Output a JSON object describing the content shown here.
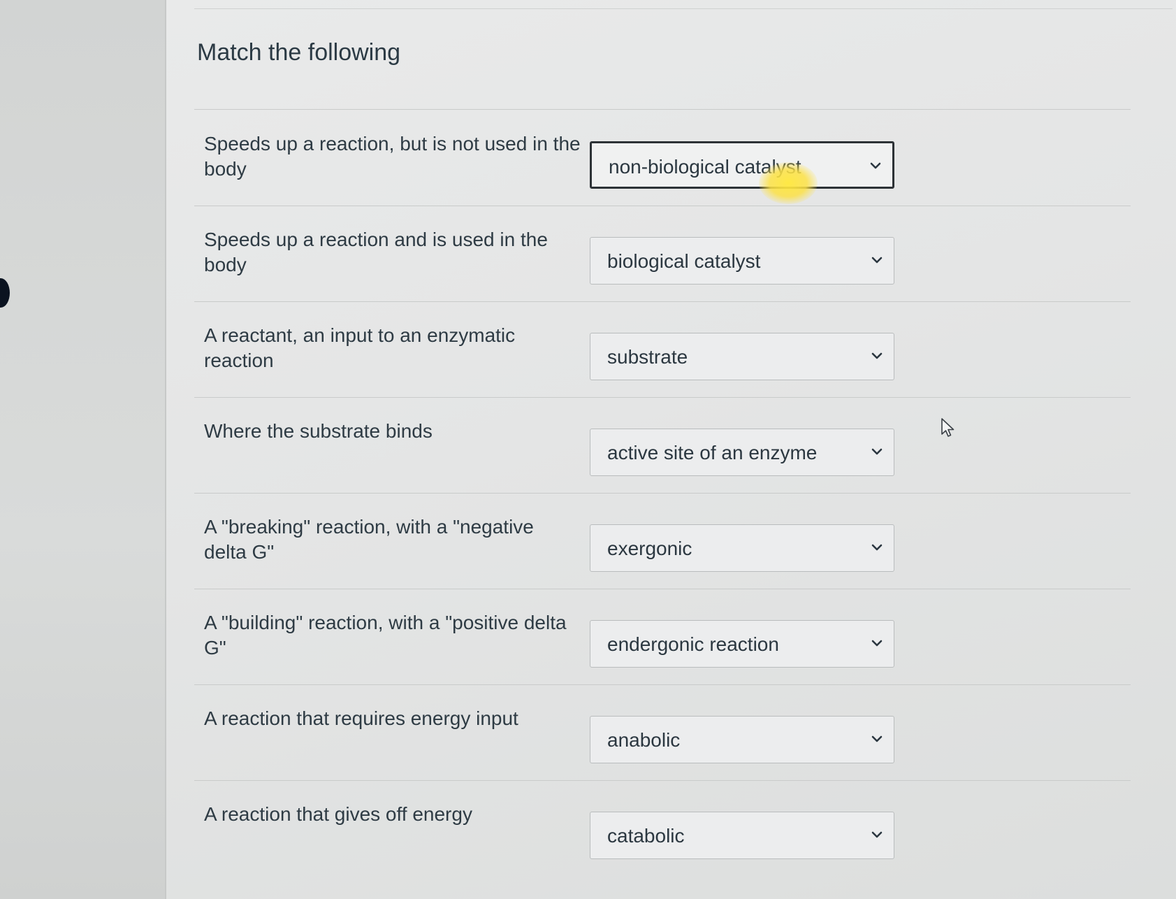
{
  "question": {
    "title": "Match the following"
  },
  "matches": [
    {
      "prompt": "Speeds up a reaction, but is not used in the body",
      "selected": "non-biological catalyst"
    },
    {
      "prompt": "Speeds up a reaction and is used in the body",
      "selected": "biological catalyst"
    },
    {
      "prompt": "A reactant, an input to an enzymatic reaction",
      "selected": "substrate"
    },
    {
      "prompt": "Where the substrate binds",
      "selected": "active site of an enzyme"
    },
    {
      "prompt": "A \"breaking\" reaction, with a \"negative delta G\"",
      "selected": "exergonic"
    },
    {
      "prompt": "A \"building\" reaction, with a \"positive delta G\"",
      "selected": "endergonic reaction"
    },
    {
      "prompt": "A reaction that requires energy input",
      "selected": "anabolic"
    },
    {
      "prompt": "A reaction that gives off energy",
      "selected": "catabolic"
    }
  ],
  "icons": {
    "dropdown": "chevron-down-icon",
    "pointer": "mouse-pointer-icon"
  },
  "colors": {
    "highlight": "#ffe83c",
    "focus_border": "#2d3236"
  }
}
